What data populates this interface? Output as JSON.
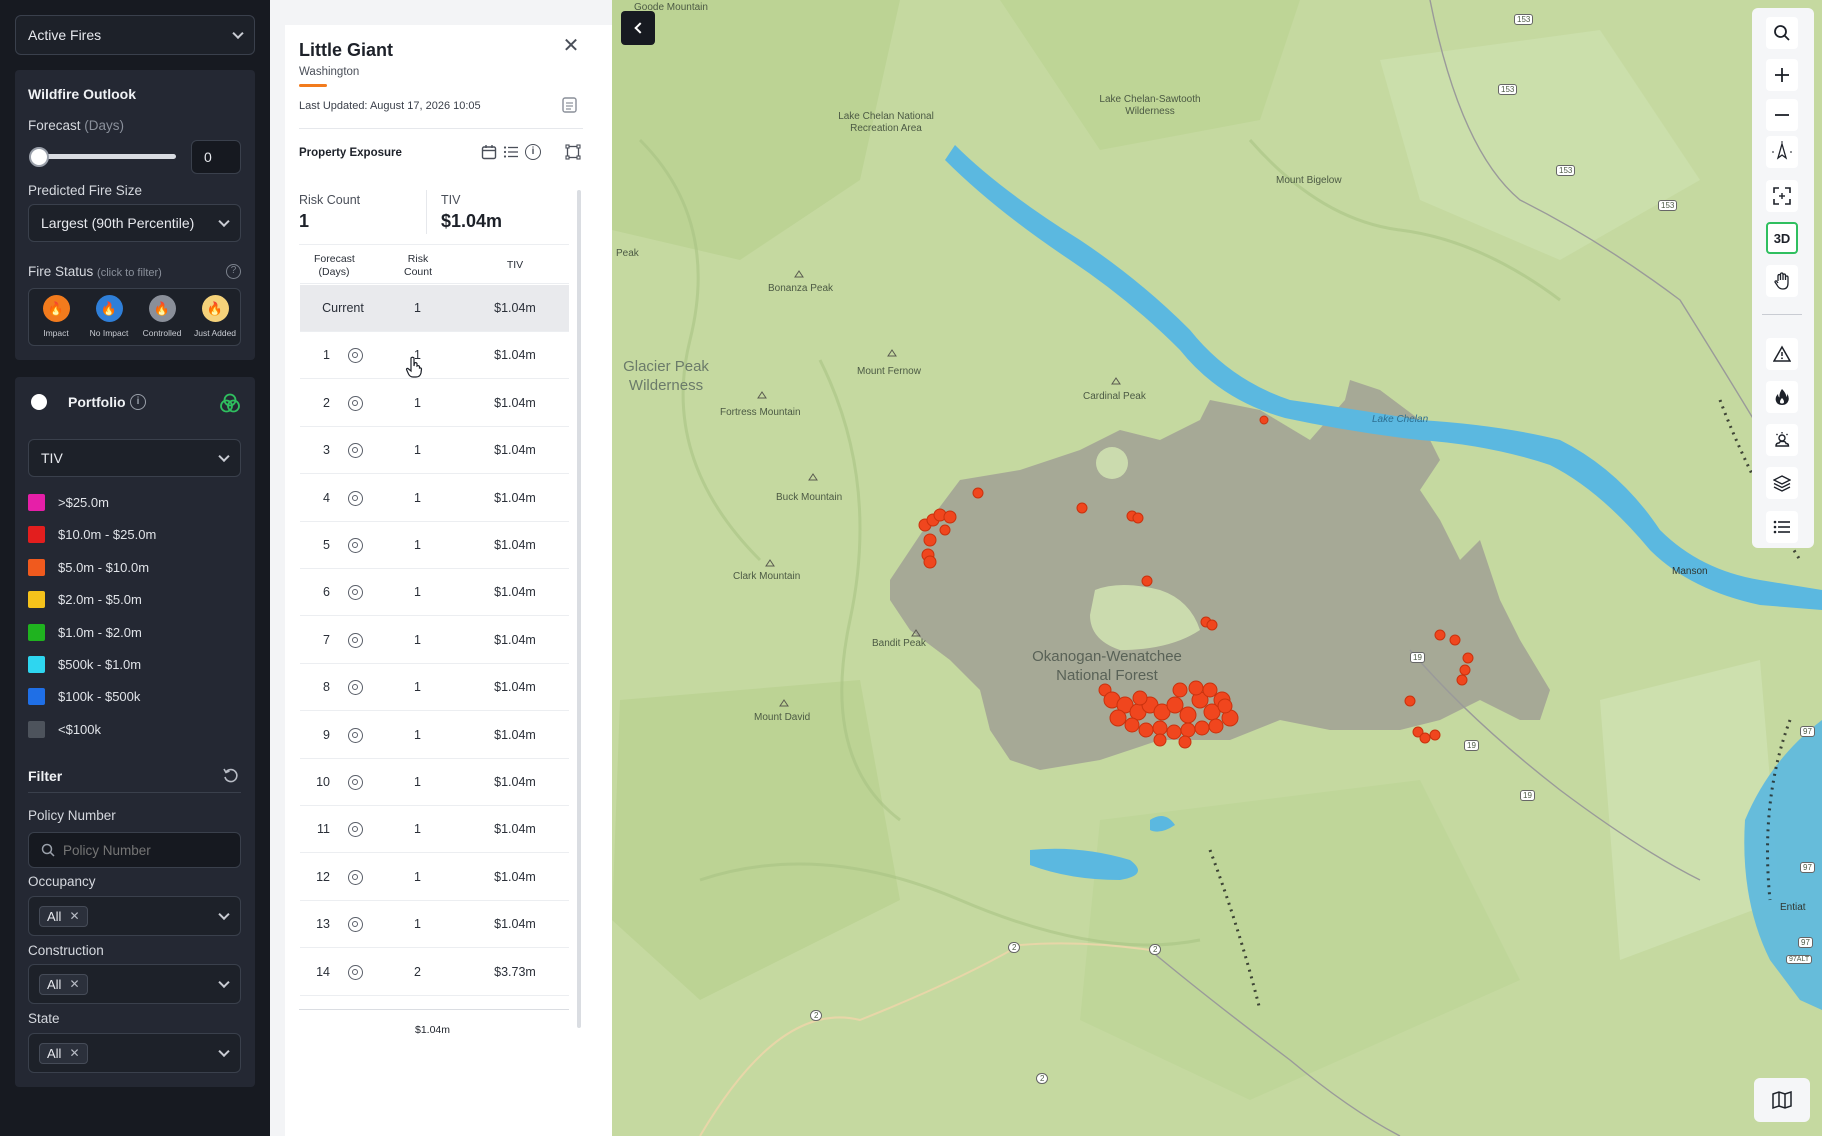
{
  "sidebar": {
    "layer_select": "Active Fires",
    "outlook": {
      "title": "Wildfire Outlook",
      "forecast_label": "Forecast",
      "forecast_unit": "(Days)",
      "forecast_value": "0",
      "forecast_slider_fraction": 0,
      "fire_size_label": "Predicted Fire Size",
      "fire_size_value": "Largest (90th Percentile)",
      "status_label": "Fire Status",
      "status_hint": "(click to filter)",
      "statuses": [
        {
          "label": "Impact",
          "color": "#f27b1d"
        },
        {
          "label": "No Impact",
          "color": "#2f7fd8"
        },
        {
          "label": "Controlled",
          "color": "#8a8f99"
        },
        {
          "label": "Just Added",
          "color": "#f5d27a"
        }
      ]
    },
    "portfolio": {
      "title": "Portfolio",
      "metric_select": "TIV",
      "legend": [
        {
          "label": ">$25.0m",
          "color": "#e61fa8"
        },
        {
          "label": "$10.0m - $25.0m",
          "color": "#e31e1e"
        },
        {
          "label": "$5.0m - $10.0m",
          "color": "#f05a1e"
        },
        {
          "label": "$2.0m - $5.0m",
          "color": "#f5c21b"
        },
        {
          "label": "$1.0m - $2.0m",
          "color": "#1fb31f"
        },
        {
          "label": "$500k - $1.0m",
          "color": "#2ed6f0"
        },
        {
          "label": "$100k - $500k",
          "color": "#1f6fe6"
        },
        {
          "label": "<$100k",
          "color": "#4d535c"
        }
      ]
    },
    "filter": {
      "title": "Filter",
      "policy_label": "Policy Number",
      "policy_placeholder": "Policy Number",
      "occupancy_label": "Occupancy",
      "occupancy_chip": "All",
      "construction_label": "Construction",
      "construction_chip": "All",
      "state_label": "State",
      "state_chip": "All"
    }
  },
  "panel": {
    "title": "Little Giant",
    "subtitle": "Washington",
    "updated": "Last Updated: August 17, 2026 10:05",
    "section": "Property Exposure",
    "risk_count_label": "Risk Count",
    "risk_count_value": "1",
    "tiv_label": "TIV",
    "tiv_value": "$1.04m",
    "table_headers": [
      "Forecast (Days)",
      "Risk Count",
      "TIV"
    ],
    "rows": [
      {
        "day": "Current",
        "count": "1",
        "tiv": "$1.04m"
      },
      {
        "day": "1",
        "count": "1",
        "tiv": "$1.04m"
      },
      {
        "day": "2",
        "count": "1",
        "tiv": "$1.04m"
      },
      {
        "day": "3",
        "count": "1",
        "tiv": "$1.04m"
      },
      {
        "day": "4",
        "count": "1",
        "tiv": "$1.04m"
      },
      {
        "day": "5",
        "count": "1",
        "tiv": "$1.04m"
      },
      {
        "day": "6",
        "count": "1",
        "tiv": "$1.04m"
      },
      {
        "day": "7",
        "count": "1",
        "tiv": "$1.04m"
      },
      {
        "day": "8",
        "count": "1",
        "tiv": "$1.04m"
      },
      {
        "day": "9",
        "count": "1",
        "tiv": "$1.04m"
      },
      {
        "day": "10",
        "count": "1",
        "tiv": "$1.04m"
      },
      {
        "day": "11",
        "count": "1",
        "tiv": "$1.04m"
      },
      {
        "day": "12",
        "count": "1",
        "tiv": "$1.04m"
      },
      {
        "day": "13",
        "count": "1",
        "tiv": "$1.04m"
      },
      {
        "day": "14",
        "count": "2",
        "tiv": "$3.73m"
      }
    ],
    "footer_value": "$1.04m"
  },
  "map": {
    "labels": [
      "Goode Mountain",
      "Lake Chelan National Recreation Area",
      "Lake Chelan-Sawtooth Wilderness",
      "Mount Bigelow",
      "Peak",
      "Bonanza Peak",
      "Glacier Peak Wilderness",
      "Mount Fernow",
      "Fortress Mountain",
      "Cardinal Peak",
      "Lake Chelan",
      "Buck Mountain",
      "Clark Mountain",
      "Bandit Peak",
      "Okanogan-Wenatchee National Forest",
      "Mount David",
      "Manson",
      "Entiat"
    ],
    "route_shields": [
      "153",
      "153",
      "153",
      "153",
      "19",
      "19",
      "19",
      "2",
      "2",
      "2",
      "2",
      "97",
      "97",
      "97",
      "97ALT"
    ],
    "controls": {
      "three_d": "3D"
    }
  }
}
